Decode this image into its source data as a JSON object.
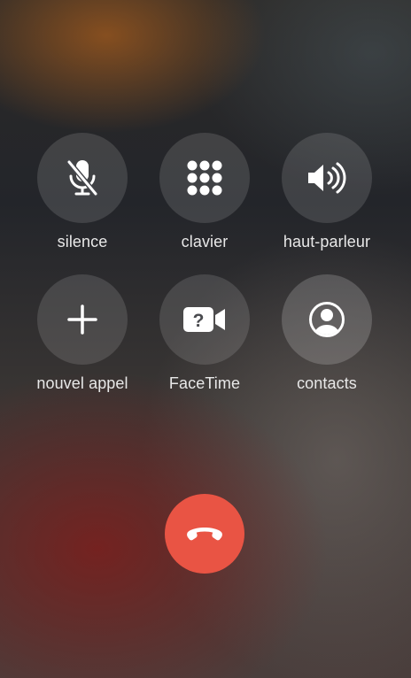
{
  "controls": [
    {
      "id": "silence",
      "label": "silence",
      "icon": "mic-slash-icon"
    },
    {
      "id": "clavier",
      "label": "clavier",
      "icon": "keypad-icon"
    },
    {
      "id": "haut-parleur",
      "label": "haut-parleur",
      "icon": "speaker-icon"
    },
    {
      "id": "nouvel-appel",
      "label": "nouvel appel",
      "icon": "plus-icon"
    },
    {
      "id": "facetime",
      "label": "FaceTime",
      "icon": "facetime-question-icon"
    },
    {
      "id": "contacts",
      "label": "contacts",
      "icon": "contact-icon"
    }
  ],
  "end_call": {
    "icon": "phone-down-icon",
    "color": "#e95444"
  },
  "colors": {
    "button_bg": "rgba(255,255,255,0.13)",
    "label": "#e8e8e8",
    "icon": "#ffffff"
  }
}
